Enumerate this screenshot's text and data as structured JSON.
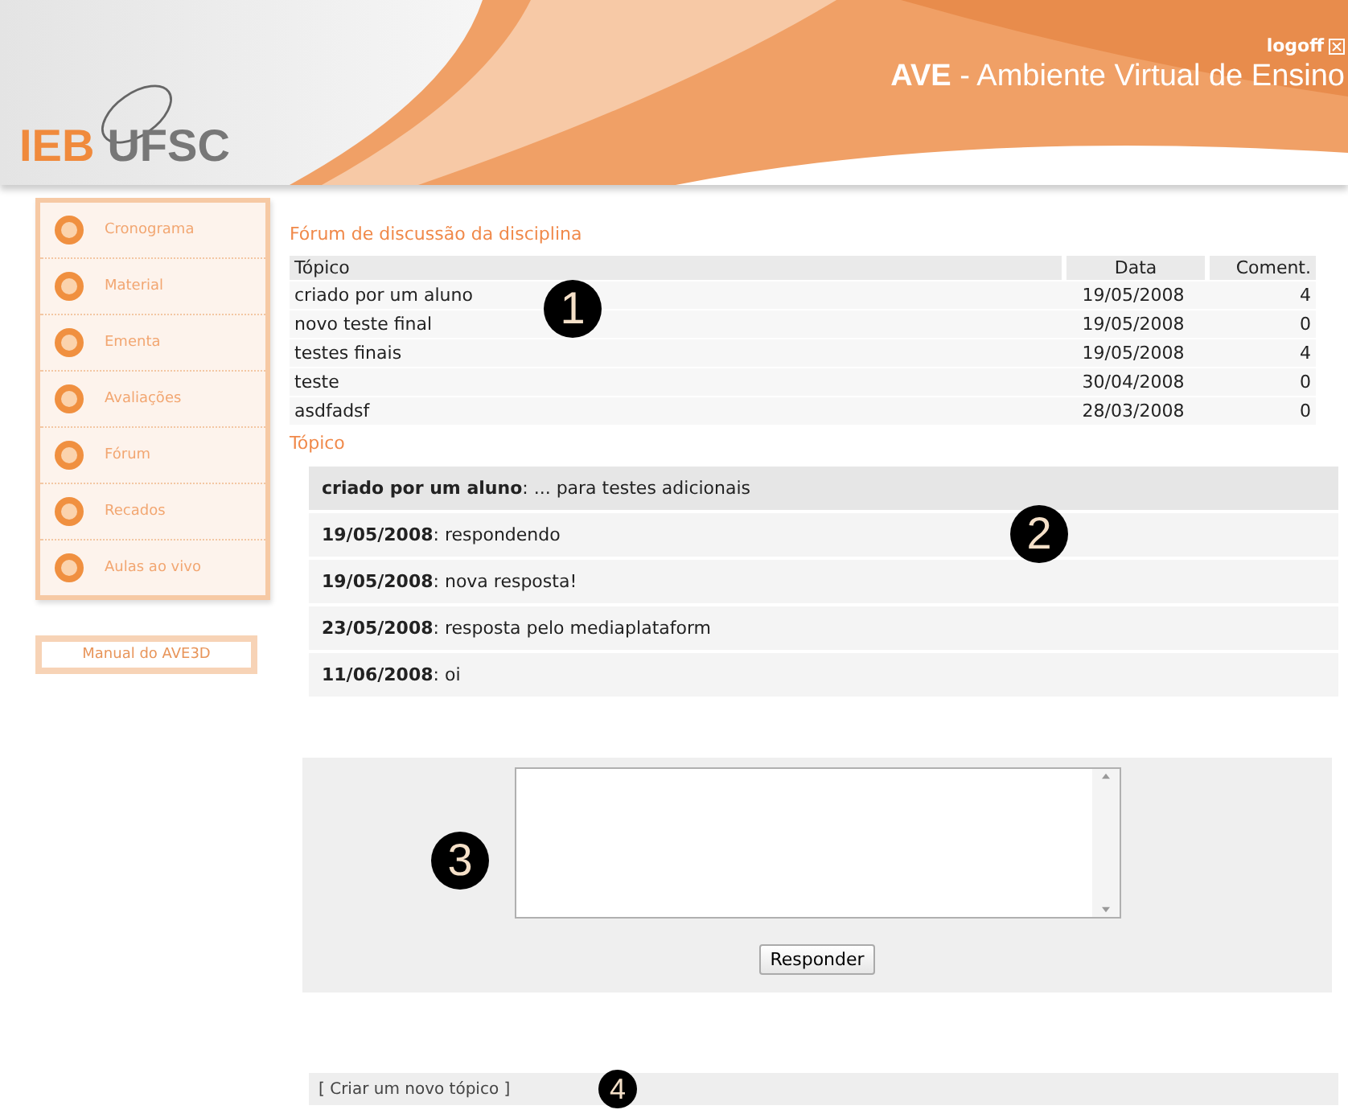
{
  "header": {
    "logo_left": "IEB",
    "logo_right": "UFSC",
    "logoff": "logoff",
    "title_bold": "AVE",
    "title_rest": " - Ambiente Virtual de Ensino"
  },
  "sidebar": {
    "items": [
      {
        "label": "Cronograma"
      },
      {
        "label": "Material"
      },
      {
        "label": "Ementa"
      },
      {
        "label": "Avaliações"
      },
      {
        "label": "Fórum"
      },
      {
        "label": "Recados"
      },
      {
        "label": "Aulas ao vivo"
      }
    ],
    "manual": "Manual do AVE3D"
  },
  "forum": {
    "title": "Fórum de discussão da disciplina",
    "columns": [
      "Tópico",
      "Data",
      "Coment."
    ],
    "rows": [
      [
        "criado por um aluno",
        "19/05/2008",
        "4"
      ],
      [
        "novo teste final",
        "19/05/2008",
        "0"
      ],
      [
        "testes finais",
        "19/05/2008",
        "4"
      ],
      [
        "teste",
        "30/04/2008",
        "0"
      ],
      [
        "asdfadsf",
        "28/03/2008",
        "0"
      ]
    ]
  },
  "topic": {
    "heading": "Tópico",
    "lead": "**criado por um aluno**: ... para testes adicionais",
    "replies": [
      "**19/05/2008**: respondendo",
      "**19/05/2008**: nova resposta!",
      "**23/05/2008**: resposta pelo mediaplataform",
      "**11/06/2008**: oi"
    ]
  },
  "reply": {
    "button": "Responder"
  },
  "new_topic_link": "[ Criar um novo tópico ]",
  "markers": [
    "1",
    "2",
    "3",
    "4"
  ]
}
